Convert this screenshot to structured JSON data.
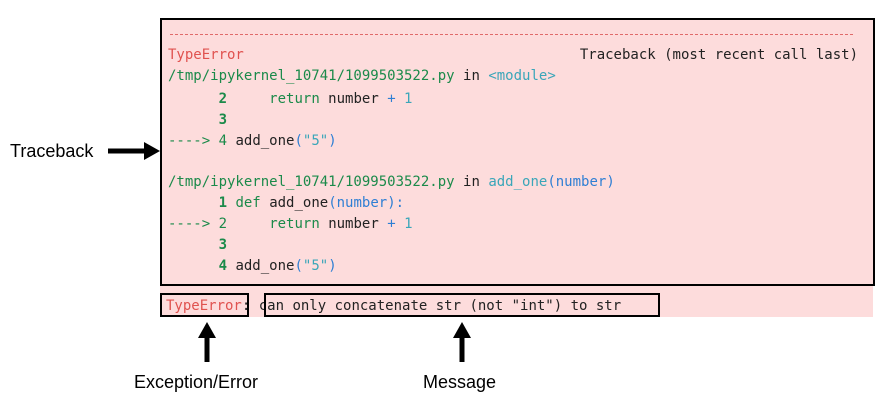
{
  "traceback": {
    "dashes": "------------------------------------------------------------------------",
    "header": {
      "error_type": "TypeError",
      "header_right": "Traceback (most recent call last)"
    },
    "frame1": {
      "file": "/tmp/ipykernel_10741/1099503522.py",
      "in_word": "in",
      "func": "<module>",
      "lines": [
        {
          "prefix": "      ",
          "num": "2",
          "pad": "     ",
          "kw": "return",
          "rest_name": " number ",
          "op": "+",
          "lit": " 1"
        },
        {
          "prefix": "      ",
          "num": "3"
        },
        {
          "arrow": "---->",
          "num": "4",
          "call": "add_one",
          "args": "(\"5\")"
        }
      ]
    },
    "frame2": {
      "file": "/tmp/ipykernel_10741/1099503522.py",
      "in_word": "in",
      "func": "add_one",
      "func_args": "(number)",
      "lines": [
        {
          "num": "1",
          "kw": "def",
          "name": "add_one",
          "params": "(number):"
        },
        {
          "arrow": "---->",
          "num": "2",
          "kw": "return",
          "rest_name": " number ",
          "op": "+",
          "lit": " 1"
        },
        {
          "num": "3"
        },
        {
          "num": "4",
          "call": "add_one",
          "args": "(\"5\")"
        }
      ]
    }
  },
  "error_line": {
    "error_type": "TypeError",
    "colon": ":",
    "message": "can only concatenate str (not \"int\") to str"
  },
  "annotations": {
    "traceback": "Traceback",
    "exception": "Exception/Error",
    "message": "Message"
  },
  "colors": {
    "background_pink": "#fddcdc",
    "error_red": "#e0524f",
    "green": "#1b8a4a",
    "cyan": "#3aa6b9",
    "blue": "#2f7fd4"
  }
}
